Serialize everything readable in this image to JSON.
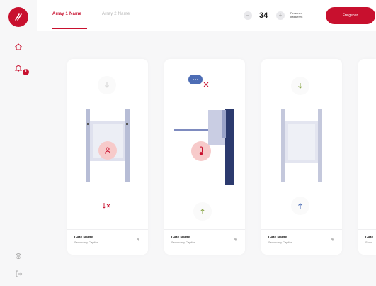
{
  "header": {
    "tabs": [
      {
        "label": "Array 1 Name",
        "active": true
      },
      {
        "label": "Array 2 Name",
        "active": false
      }
    ],
    "stepper": {
      "minus": "−",
      "plus": "+",
      "value": "34",
      "label": "Personen passieren"
    },
    "primary_button": "Freigeben"
  },
  "sidebar": {
    "logo": "logo-icon",
    "items": [
      {
        "name": "home-icon"
      },
      {
        "name": "bell-icon",
        "badge": "1"
      },
      {
        "name": "settings-icon"
      },
      {
        "name": "logout-icon"
      }
    ]
  },
  "cards": [
    {
      "name": "Gate Name",
      "sub": "Secondary Caption",
      "meta": "⇆"
    },
    {
      "name": "Gate Name",
      "sub": "Secondary Caption",
      "meta": "⇆"
    },
    {
      "name": "Gate Name",
      "sub": "Secondary Caption",
      "meta": "⇆"
    },
    {
      "name": "Gate",
      "sub": "Seco",
      "meta": ""
    }
  ],
  "colors": {
    "brand": "#c8102e",
    "green": "#8aa64a",
    "blue": "#4d6db5",
    "navy": "#2c3a6e"
  }
}
